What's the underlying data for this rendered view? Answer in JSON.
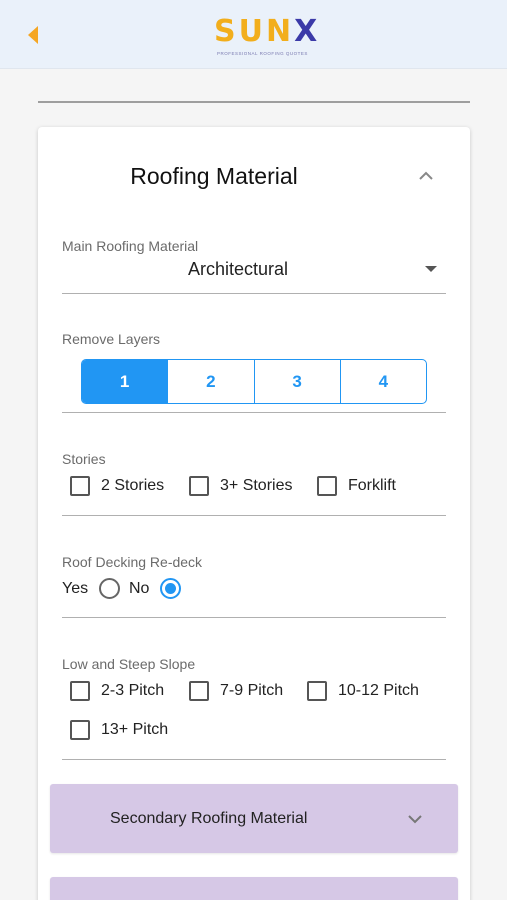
{
  "header": {
    "logo_text": "SUN",
    "logo_x": "X",
    "logo_tagline": "PROFESSIONAL ROOFING QUOTES",
    "colors": {
      "background": "#eaf1fa",
      "logo_primary": "#f2ae1c",
      "logo_accent": "#3b3aa8",
      "back_icon": "#f5a623"
    }
  },
  "roofing_material": {
    "title": "Roofing Material",
    "main_material": {
      "label": "Main Roofing Material",
      "value": "Architectural"
    },
    "remove_layers": {
      "label": "Remove Layers",
      "options": [
        "1",
        "2",
        "3",
        "4"
      ],
      "selected": "1"
    },
    "stories": {
      "label": "Stories",
      "options": [
        {
          "label": "2 Stories",
          "checked": false
        },
        {
          "label": "3+ Stories",
          "checked": false
        },
        {
          "label": "Forklift",
          "checked": false
        }
      ]
    },
    "redeck": {
      "label": "Roof Decking Re-deck",
      "yes_label": "Yes",
      "no_label": "No",
      "selected": "No"
    },
    "slope": {
      "label": "Low and Steep Slope",
      "options": [
        {
          "label": "2-3 Pitch",
          "checked": false
        },
        {
          "label": "7-9 Pitch",
          "checked": false
        },
        {
          "label": "10-12 Pitch",
          "checked": false
        },
        {
          "label": "13+ Pitch",
          "checked": false
        }
      ]
    }
  },
  "secondary": {
    "title": "Secondary Roofing Material"
  },
  "colors": {
    "accent": "#2196f3",
    "accordion": "#d6c8e6"
  }
}
